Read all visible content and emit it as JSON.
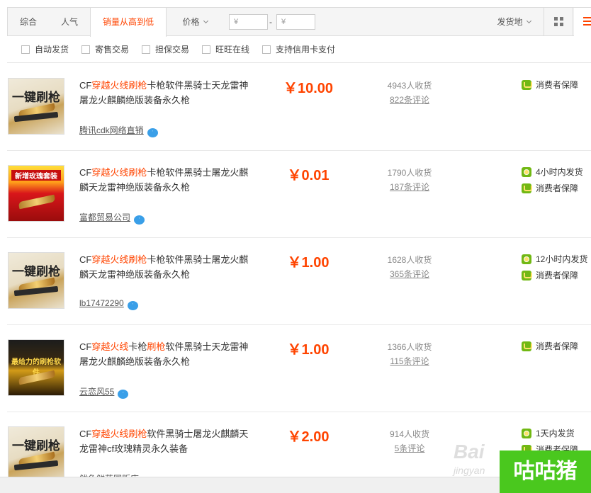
{
  "sortbar": {
    "tabs": [
      {
        "label": "综合"
      },
      {
        "label": "人气"
      },
      {
        "label": "销量从高到低"
      },
      {
        "label": "价格"
      }
    ],
    "price_min_placeholder": "¥",
    "price_max_placeholder": "¥",
    "price_separator": "-",
    "ship_from": "发货地"
  },
  "filters": [
    {
      "label": "自动发货"
    },
    {
      "label": "寄售交易"
    },
    {
      "label": "担保交易"
    },
    {
      "label": "旺旺在线"
    },
    {
      "label": "支持信用卡支付"
    }
  ],
  "items": [
    {
      "title_pre": "CF",
      "title_hl": "穿越火线刷枪",
      "title_post": "卡枪软件黑骑士天龙雷神屠龙火麒麟绝版装备永久枪",
      "thumb_text": "一键刷枪",
      "shop": "腾讯cdk网络直销",
      "price": "￥10.00",
      "sales": "4943人收货",
      "reviews": "822条评论",
      "badges": [
        "消费者保障"
      ]
    },
    {
      "title_pre": "CF",
      "title_hl": "穿越火线刷枪",
      "title_post": "卡枪软件黑骑士屠龙火麒麟天龙雷神绝版装备永久枪",
      "thumb_text": "新增玫瑰套装",
      "shop": "富都贸易公司",
      "price": "￥0.01",
      "sales": "1790人收货",
      "reviews": "187条评论",
      "badges": [
        "4小时内发货",
        "消费者保障"
      ]
    },
    {
      "title_pre": "CF",
      "title_hl": "穿越火线刷枪",
      "title_post": "卡枪软件黑骑士屠龙火麒麟天龙雷神绝版装备永久枪",
      "thumb_text": "一键刷枪",
      "shop": "lb17472290",
      "price": "￥1.00",
      "sales": "1628人收货",
      "reviews": "365条评论",
      "badges": [
        "12小时内发货",
        "消费者保障"
      ]
    },
    {
      "title_pre": "CF",
      "title_hl": "穿越火线",
      "title_mid": "卡枪",
      "title_hl2": "刷枪",
      "title_post": "软件黑骑士天龙雷神屠龙火麒麟绝版装备永久枪",
      "thumb_text": "最给力的刷枪软件",
      "shop": "云恋风55",
      "price": "￥1.00",
      "sales": "1366人收货",
      "reviews": "115条评论",
      "badges": [
        "消费者保障"
      ]
    },
    {
      "title_pre": "CF",
      "title_hl": "穿越火线刷枪",
      "title_post": "软件黑骑士屠龙火麒麟天龙雷神cf玫瑰精灵永久装备",
      "thumb_text": "一键刷枪",
      "shop": "鲅鱼鲜药园贩店",
      "price": "￥2.00",
      "sales": "914人收货",
      "reviews": "5条评论",
      "badges": [
        "1天内发货",
        "消费者保障"
      ]
    }
  ],
  "watermark": {
    "baidu": "Bai",
    "jingyan": "jingyan",
    "gugu": "咕咕猪"
  }
}
